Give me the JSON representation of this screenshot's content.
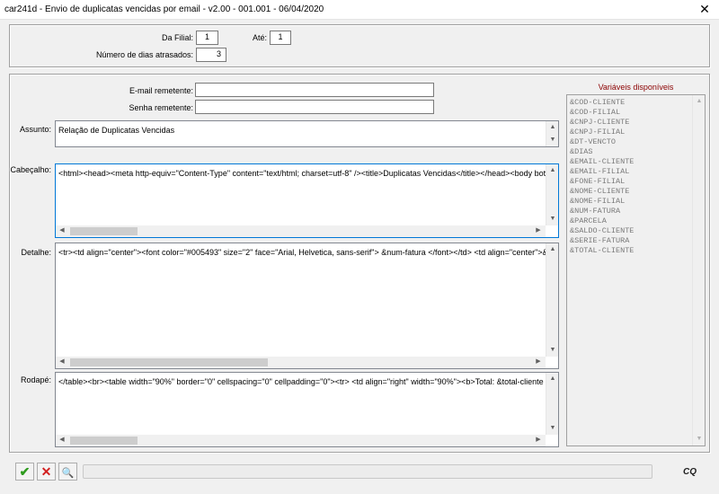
{
  "window": {
    "title": "car241d - Envio de duplicatas vencidas por email - v2.00 - 001.001 - 06/04/2020",
    "close_glyph": "✕"
  },
  "filter": {
    "da_filial_label": "Da Filial:",
    "da_filial_value": "1",
    "ate_label": "Até:",
    "ate_value": "1",
    "dias_label": "Número de dias atrasados:",
    "dias_value": "3"
  },
  "email": {
    "remetente_label": "E-mail remetente:",
    "remetente_value": "",
    "senha_label": "Senha remetente:",
    "senha_value": ""
  },
  "assunto": {
    "label": "Assunto:",
    "value": "Relação de Duplicatas Vencidas"
  },
  "cabecalho": {
    "label": "Cabeçalho:",
    "value": "<html><head><meta http-equiv=\"Content-Type\" content=\"text/html; charset=utf-8\" /><title>Duplicatas Vencidas</title></head><body bottommarg"
  },
  "detalhe": {
    "label": "Detalhe:",
    "value": "<tr><td align=\"center\"><font color=\"#005493\" size=\"2\" face=\"Arial, Helvetica, sans-serif\"> &num-fatura      </font></td>    <td align=\"center\">&pa"
  },
  "rodape": {
    "label": "Rodapé:",
    "value": "</table><br><table width=\"90%\" border=\"0\" cellspacing=\"0\" cellpadding=\"0\"><tr> <td align=\"right\" width=\"90%\"><b>Total: &total-cliente      </"
  },
  "variaveis": {
    "title": "Variáveis disponíveis",
    "items": [
      "&COD-CLIENTE",
      "&COD-FILIAL",
      "&CNPJ-CLIENTE",
      "&CNPJ-FILIAL",
      "&DT-VENCTO",
      "&DIAS",
      "&EMAIL-CLIENTE",
      "&EMAIL-FILIAL",
      "&FONE-FILIAL",
      "&NOME-CLIENTE",
      "&NOME-FILIAL",
      "&NUM-FATURA",
      "&PARCELA",
      "&SALDO-CLIENTE",
      "&SERIE-FATURA",
      "&TOTAL-CLIENTE"
    ]
  },
  "toolbar": {
    "confirm_glyph": "✔",
    "cancel_glyph": "✕",
    "preview_glyph": "🔍",
    "logo_text": "CQ"
  },
  "colors": {
    "confirm": "#2e9b1e",
    "cancel": "#d21f1f",
    "variaveis_title": "#8b0000"
  }
}
